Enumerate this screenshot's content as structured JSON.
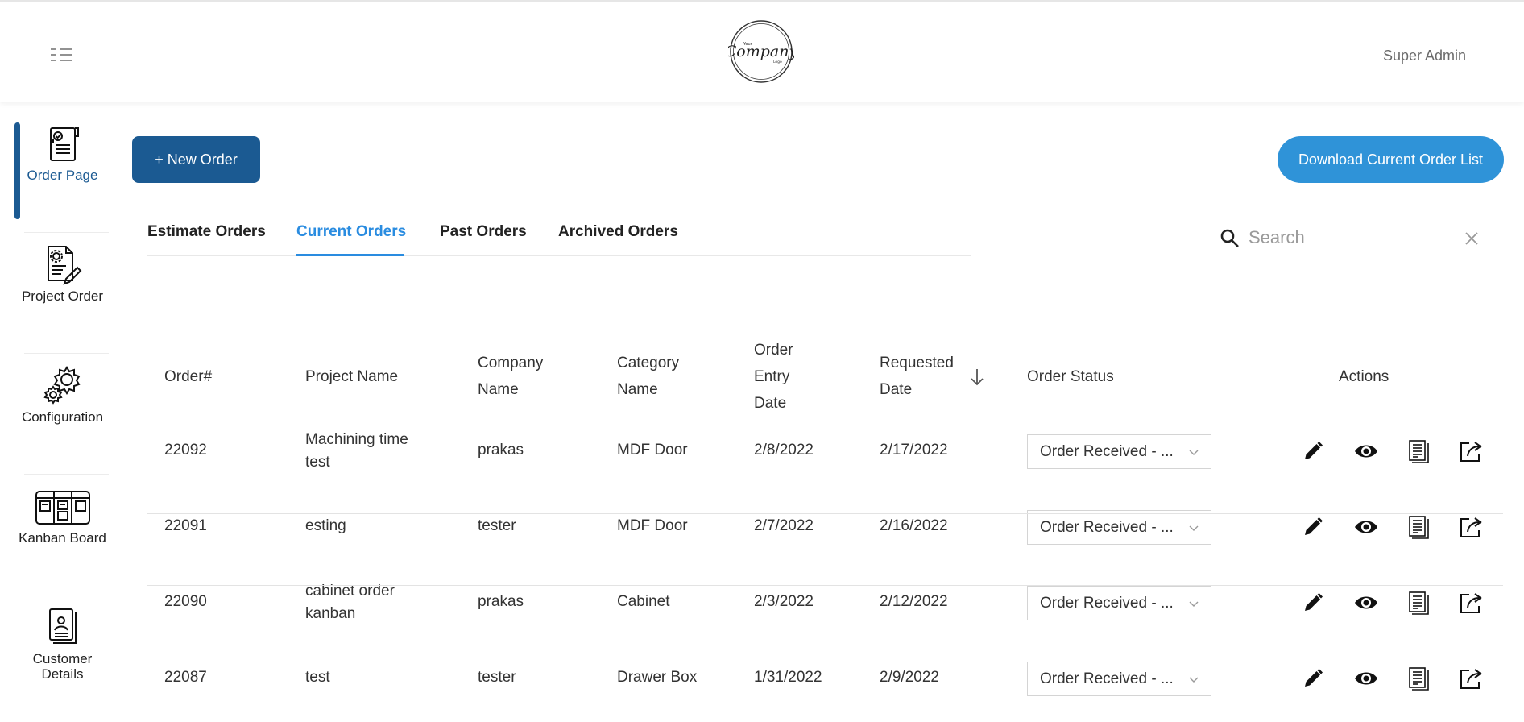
{
  "header": {
    "user_name": "Super Admin",
    "logo_top_text": "Your",
    "logo_text": "Company",
    "logo_bottom_text": "Logo"
  },
  "sidebar": {
    "items": [
      {
        "label": "Order Page",
        "icon": "order-page-icon",
        "active": true
      },
      {
        "label": "Project Order",
        "icon": "project-order-icon"
      },
      {
        "label": "Configuration",
        "icon": "gears-icon"
      },
      {
        "label": "Kanban Board",
        "icon": "kanban-board-icon"
      },
      {
        "label": "Customer Details",
        "icon": "customer-details-icon"
      }
    ]
  },
  "toolbar": {
    "new_order_label": "+ New Order",
    "download_label": "Download Current Order List"
  },
  "tabs": [
    {
      "label": "Estimate Orders"
    },
    {
      "label": "Current Orders",
      "active": true
    },
    {
      "label": "Past Orders"
    },
    {
      "label": "Archived Orders"
    }
  ],
  "search": {
    "placeholder": "Search",
    "value": ""
  },
  "table": {
    "headers": {
      "order_no": "Order#",
      "project_name": "Project Name",
      "company_name_1": "Company",
      "company_name_2": "Name",
      "category_name_1": "Category",
      "category_name_2": "Name",
      "entry_date_1": "Order",
      "entry_date_2": "Entry",
      "entry_date_3": "Date",
      "requested_1": "Requested",
      "requested_2": "Date",
      "status": "Order Status",
      "actions": "Actions"
    },
    "rows": [
      {
        "order": "22092",
        "project_1": "Machining time",
        "project_2": "test",
        "company": "prakas",
        "category": "MDF Door",
        "entry": "2/8/2022",
        "requested": "2/17/2022",
        "status": "Order Received - ..."
      },
      {
        "order": "22091",
        "project_1": "esting",
        "project_2": "",
        "company": "tester",
        "category": "MDF Door",
        "entry": "2/7/2022",
        "requested": "2/16/2022",
        "status": "Order Received - ..."
      },
      {
        "order": "22090",
        "project_1": "cabinet order",
        "project_2": "kanban",
        "company": "prakas",
        "category": "Cabinet",
        "entry": "2/3/2022",
        "requested": "2/12/2022",
        "status": "Order Received - ..."
      },
      {
        "order": "22087",
        "project_1": "test",
        "project_2": "",
        "company": "tester",
        "category": "Drawer Box",
        "entry": "1/31/2022",
        "requested": "2/9/2022",
        "status": "Order Received - ..."
      }
    ]
  },
  "colors": {
    "primary": "#1b5a92",
    "accent": "#2f93d8",
    "active_tab": "#2a8ce0"
  }
}
